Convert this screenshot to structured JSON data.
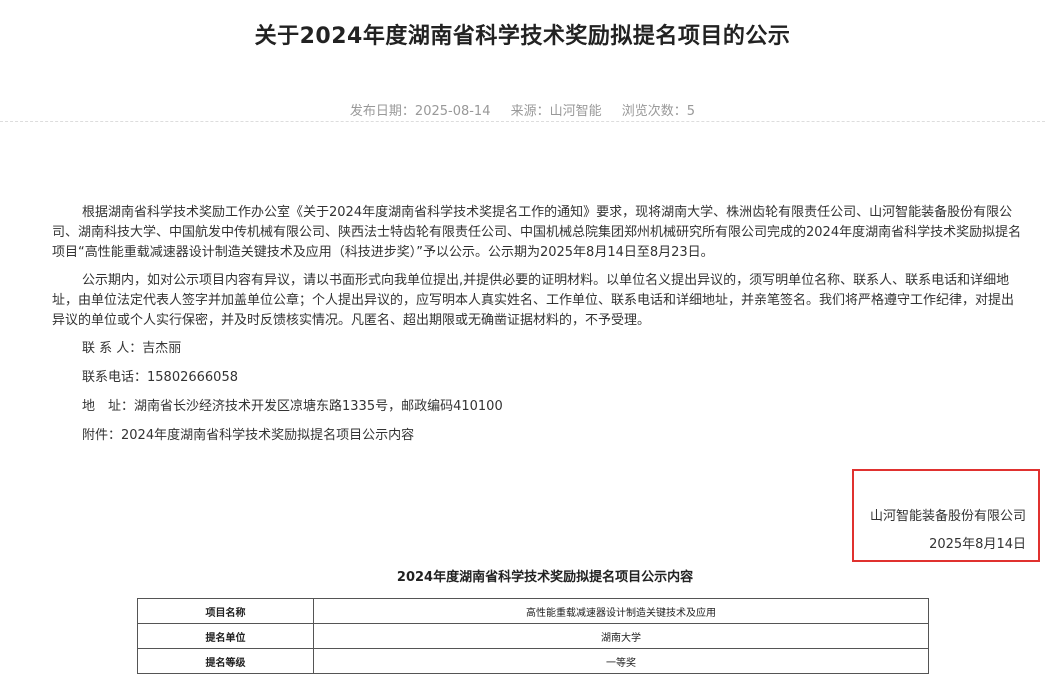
{
  "title": "关于2024年度湖南省科学技术奖励拟提名项目的公示",
  "meta": {
    "publish_date": "发布日期：2025-08-14",
    "source": "来源：山河智能",
    "views": "浏览次数：5"
  },
  "paragraphs": [
    "根据湖南省科学技术奖励工作办公室《关于2024年度湖南省科学技术奖提名工作的通知》要求，现将湖南大学、株洲齿轮有限责任公司、山河智能装备股份有限公司、湖南科技大学、中国航发中传机械有限公司、陕西法士特齿轮有限责任公司、中国机械总院集团郑州机械研究所有限公司完成的2024年度湖南省科学技术奖励拟提名项目“高性能重载减速器设计制造关键技术及应用（科技进步奖）”予以公示。公示期为2025年8月14日至8月23日。",
    "公示期内，如对公示项目内容有异议，请以书面形式向我单位提出,并提供必要的证明材料。以单位名义提出异议的，须写明单位名称、联系人、联系电话和详细地址，由单位法定代表人签字并加盖单位公章；个人提出异议的，应写明本人真实姓名、工作单位、联系电话和详细地址，并亲笔签名。我们将严格遵守工作纪律，对提出异议的单位或个人实行保密，并及时反馈核实情况。凡匿名、超出期限或无确凿证据材料的，不予受理。"
  ],
  "contact": {
    "person": "联 系 人：吉杰丽",
    "phone": "联系电话：15802666058",
    "address": "地　址：湖南省长沙经济技术开发区凉塘东路1335号，邮政编码410100",
    "attachment": "附件：2024年度湖南省科学技术奖励拟提名项目公示内容"
  },
  "signature": {
    "org": "山河智能装备股份有限公司",
    "date": "2025年8月14日",
    "box_color": "#e0312f"
  },
  "attachment_section": {
    "title": "2024年度湖南省科学技术奖励拟提名项目公示内容",
    "rows": [
      {
        "label": "项目名称",
        "value": "高性能重载减速器设计制造关键技术及应用"
      },
      {
        "label": "提名单位",
        "value": "湖南大学"
      },
      {
        "label": "提名等级",
        "value": "一等奖"
      }
    ]
  }
}
